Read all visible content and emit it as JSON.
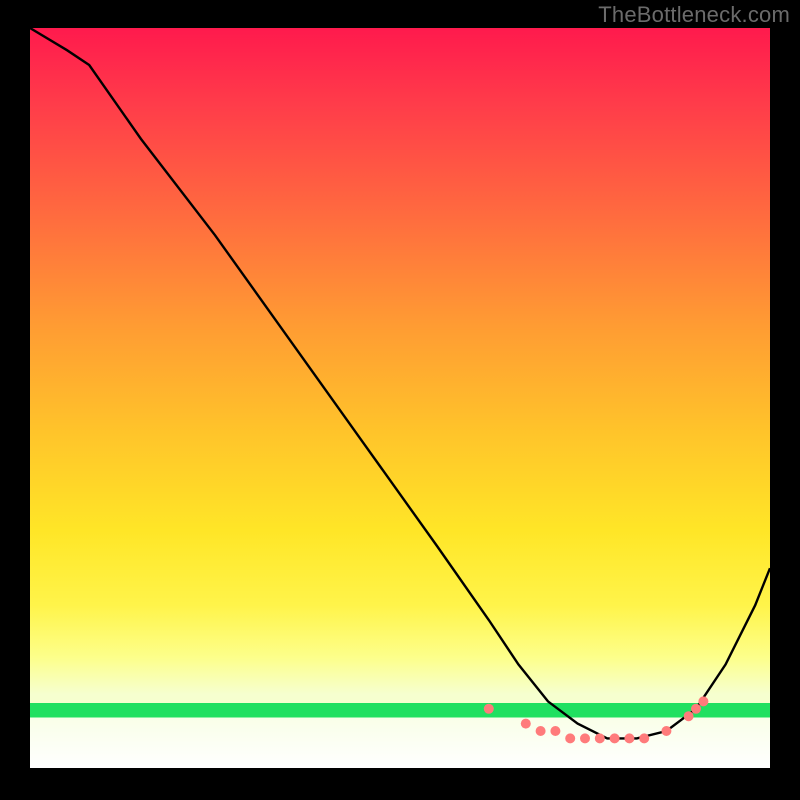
{
  "watermark": "TheBottleneck.com",
  "colors": {
    "background": "#000000",
    "curve": "#000000",
    "dots": "#ff7b7b",
    "gradient_top": "#ff1a4d",
    "gradient_mid": "#ffe627",
    "gradient_low": "#f6ffcf",
    "green_band": "#20e060"
  },
  "chart_data": {
    "type": "line",
    "title": "",
    "xlabel": "",
    "ylabel": "",
    "xlim": [
      0,
      100
    ],
    "ylim": [
      0,
      100
    ],
    "legend": false,
    "series": [
      {
        "name": "bottleneck-curve",
        "x": [
          0,
          5,
          8,
          15,
          25,
          35,
          45,
          55,
          62,
          66,
          70,
          74,
          78,
          82,
          86,
          90,
          94,
          98,
          100
        ],
        "values": [
          100,
          97,
          95,
          85,
          72,
          58,
          44,
          30,
          20,
          14,
          9,
          6,
          4,
          4,
          5,
          8,
          14,
          22,
          27
        ]
      }
    ],
    "markers": {
      "name": "highlight-dots",
      "x": [
        62,
        67,
        69,
        71,
        73,
        75,
        77,
        79,
        81,
        83,
        86,
        89,
        90,
        91
      ],
      "values": [
        8,
        6,
        5,
        5,
        4,
        4,
        4,
        4,
        4,
        4,
        5,
        7,
        8,
        9
      ]
    }
  }
}
